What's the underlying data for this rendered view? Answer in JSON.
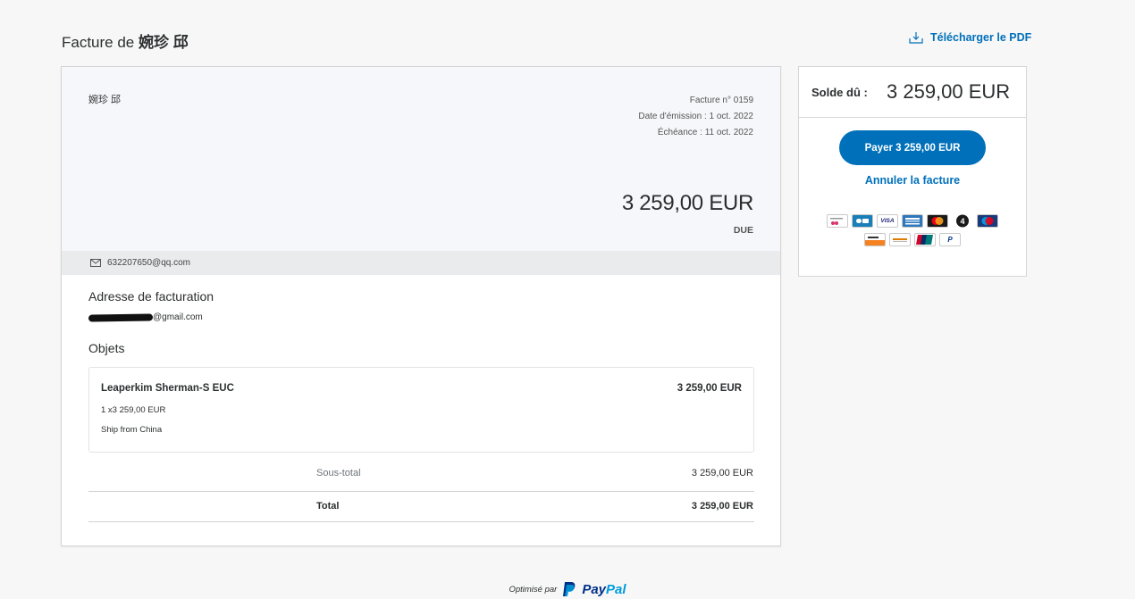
{
  "header": {
    "title_prefix": "Facture de",
    "title_name": "婉珍 邱",
    "download_label": "Télécharger le PDF"
  },
  "invoice": {
    "merchant_name": "婉珍 邱",
    "number_line": "Facture n° 0159",
    "issue_date_line": "Date d'émission : 1 oct. 2022",
    "due_date_line": "Échéance : 11 oct. 2022",
    "amount": "3 259,00 EUR",
    "status": "DUE",
    "merchant_email": "632207650@qq.com",
    "billing_title": "Adresse de facturation",
    "billing_email_suffix": "@gmail.com",
    "items_title": "Objets",
    "items": [
      {
        "name": "Leaperkim Sherman-S EUC",
        "price": "3 259,00 EUR",
        "qty_line": "1 x3 259,00 EUR",
        "description": "Ship from China"
      }
    ],
    "subtotal_label": "Sous-total",
    "subtotal_value": "3 259,00 EUR",
    "total_label": "Total",
    "total_value": "3 259,00 EUR"
  },
  "side": {
    "balance_label": "Solde dû :",
    "balance_amount": "3 259,00 EUR",
    "pay_button_label": "Payer 3 259,00 EUR",
    "cancel_label": "Annuler la facture",
    "card_icons_row1": [
      "cofinoga-icon",
      "carte-bancaire-icon",
      "visa-icon",
      "amex-icon",
      "mastercard-icon",
      "cetelem-4x-icon",
      "maestro-icon"
    ],
    "card_icons_row2": [
      "discover-icon",
      "aurore-icon",
      "unionpay-icon",
      "paypal-icon"
    ]
  },
  "footer": {
    "optimized_by": "Optimisé par",
    "brand_a": "Pay",
    "brand_b": "Pal"
  },
  "colors": {
    "accent": "#0070ba",
    "paypal_dark": "#003087",
    "paypal_light": "#009cde"
  }
}
